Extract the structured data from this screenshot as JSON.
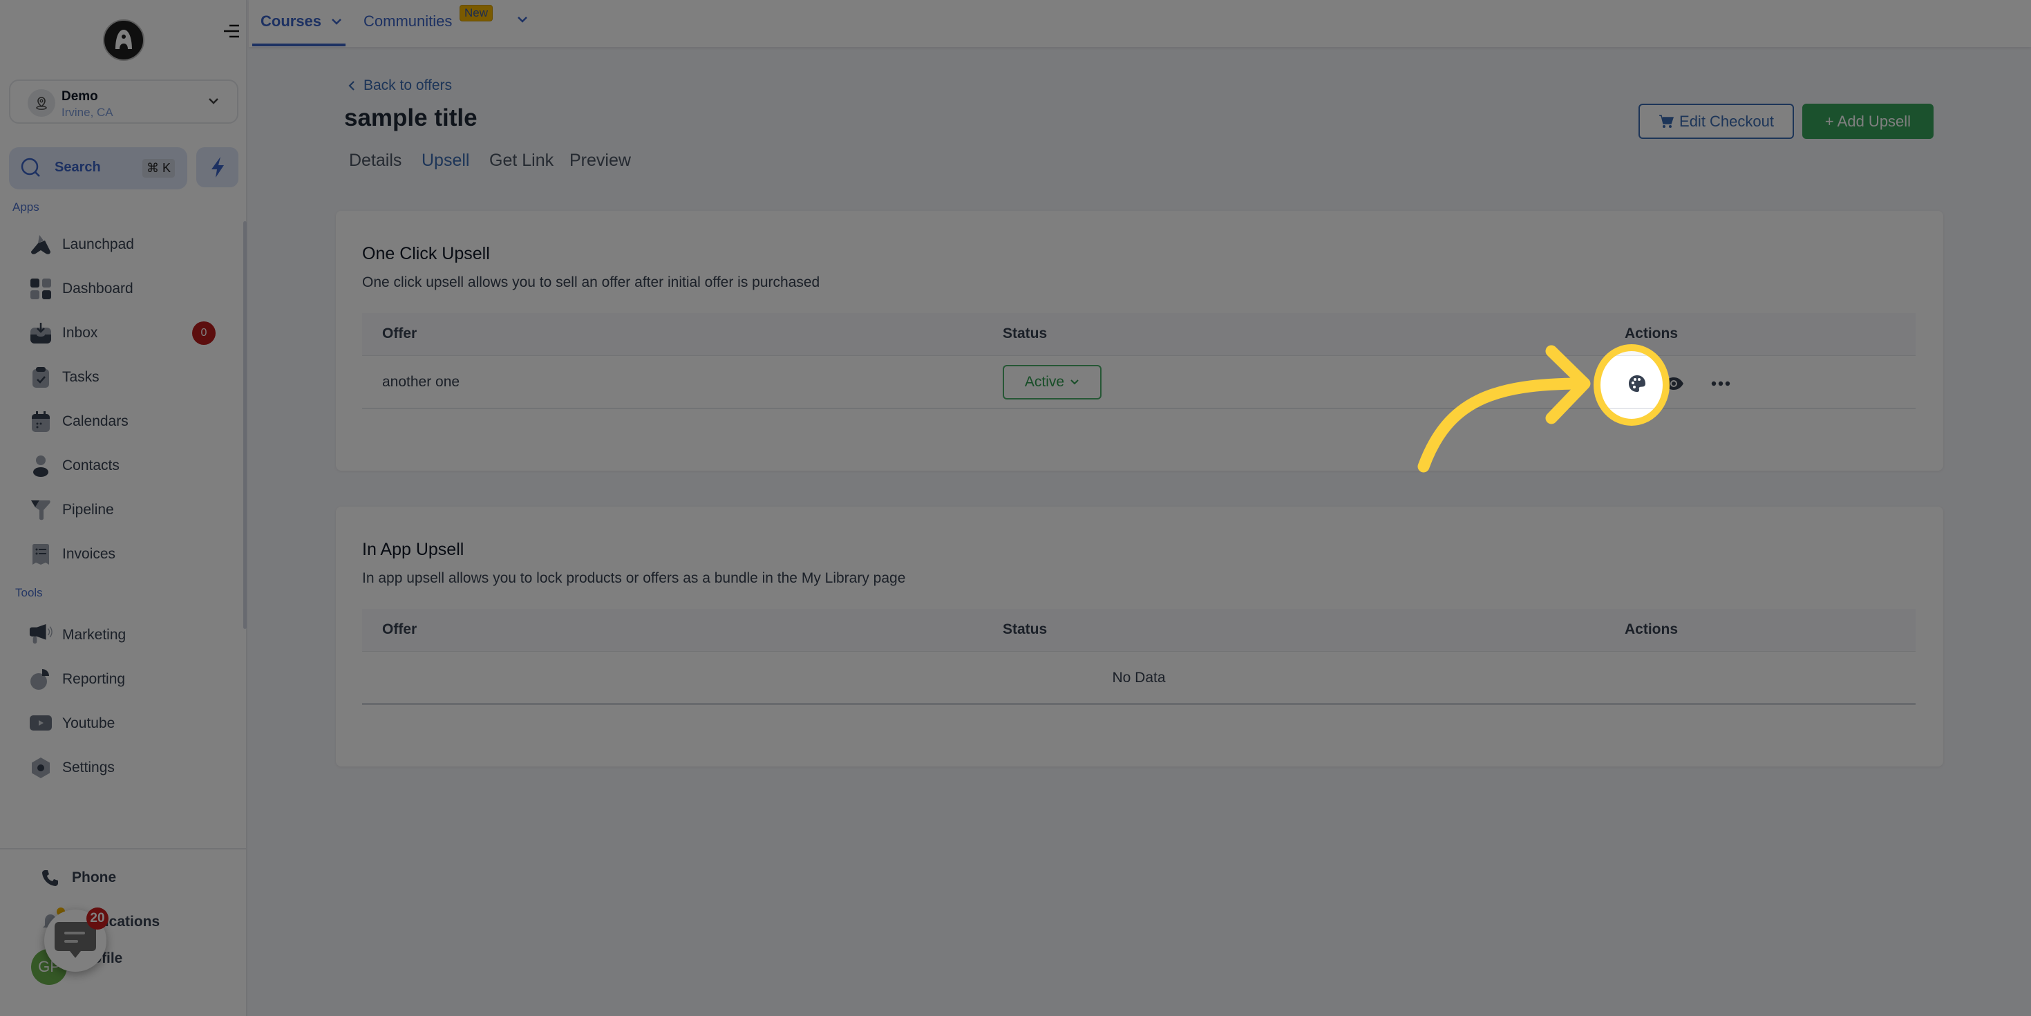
{
  "sidebar": {
    "location": {
      "name": "Demo",
      "city": "Irvine, CA"
    },
    "search": {
      "label": "Search",
      "shortcut": "⌘ K"
    },
    "apps_label": "Apps",
    "apps": [
      {
        "label": "Launchpad",
        "icon": "launchpad-icon"
      },
      {
        "label": "Dashboard",
        "icon": "dashboard-icon"
      },
      {
        "label": "Inbox",
        "icon": "inbox-icon",
        "badge": "0"
      },
      {
        "label": "Tasks",
        "icon": "tasks-icon"
      },
      {
        "label": "Calendars",
        "icon": "calendar-icon"
      },
      {
        "label": "Contacts",
        "icon": "contacts-icon"
      },
      {
        "label": "Pipeline",
        "icon": "pipeline-icon"
      },
      {
        "label": "Invoices",
        "icon": "invoices-icon"
      }
    ],
    "tools_label": "Tools",
    "tools": [
      {
        "label": "Marketing",
        "icon": "megaphone-icon"
      },
      {
        "label": "Reporting",
        "icon": "pie-chart-icon"
      },
      {
        "label": "Youtube",
        "icon": "youtube-icon"
      },
      {
        "label": "Settings",
        "icon": "settings-icon"
      }
    ],
    "bottom": {
      "phone": "Phone",
      "notifications": "Notifications",
      "profile": "Profile",
      "avatar_initials": "GP",
      "chat_badge": "20"
    }
  },
  "topnav": {
    "tabs": [
      {
        "label": "Courses",
        "active": true
      },
      {
        "label": "Communities",
        "badge": "New"
      }
    ]
  },
  "page": {
    "back_link": "Back to offers",
    "title": "sample title",
    "tabs": [
      "Details",
      "Upsell",
      "Get Link",
      "Preview"
    ],
    "active_tab": "Upsell",
    "edit_checkout": "Edit Checkout",
    "add_upsell": "+ Add Upsell"
  },
  "one_click": {
    "title": "One Click Upsell",
    "description": "One click upsell allows you to sell an offer after initial offer is purchased",
    "columns": [
      "Offer",
      "Status",
      "Actions"
    ],
    "rows": [
      {
        "offer": "another one",
        "status": "Active"
      }
    ]
  },
  "in_app": {
    "title": "In App Upsell",
    "description": "In app upsell allows you to lock products or offers as a bundle in the My Library page",
    "columns": [
      "Offer",
      "Status",
      "Actions"
    ],
    "empty": "No Data"
  },
  "colors": {
    "accent": "#3a63c4",
    "success": "#37a25a",
    "highlight": "#fdd13a",
    "badge": "#b91c1c"
  }
}
